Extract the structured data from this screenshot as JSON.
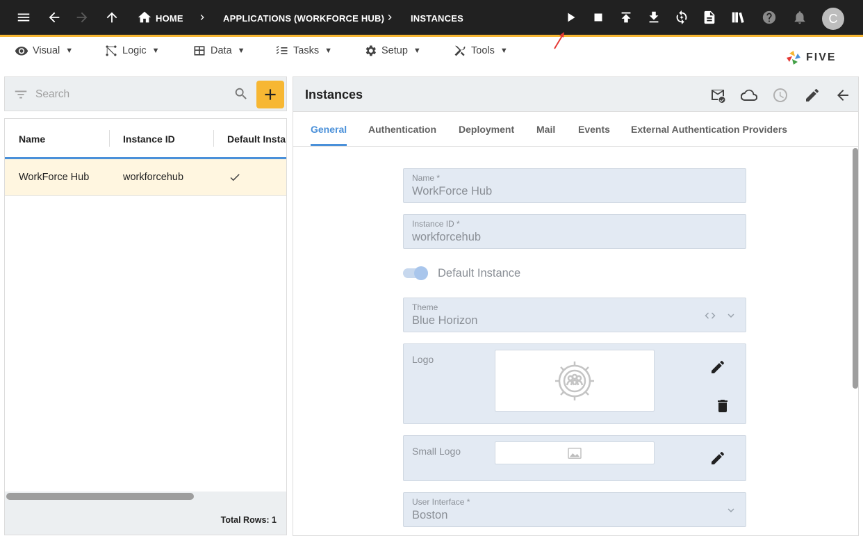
{
  "topbar": {
    "breadcrumbs": [
      "HOME",
      "APPLICATIONS (WORKFORCE HUB)",
      "INSTANCES"
    ],
    "avatar_initial": "C",
    "icons": [
      "menu-icon",
      "back-arrow-icon",
      "forward-arrow-icon",
      "up-arrow-icon",
      "home-icon",
      "play-icon",
      "stop-icon",
      "publish-icon",
      "download-icon",
      "sync-icon",
      "document-icon",
      "library-icon",
      "help-icon",
      "notifications-icon"
    ]
  },
  "menubar": {
    "items": [
      {
        "label": "Visual",
        "icon": "eye-icon"
      },
      {
        "label": "Logic",
        "icon": "flow-icon"
      },
      {
        "label": "Data",
        "icon": "table-icon"
      },
      {
        "label": "Tasks",
        "icon": "checklist-icon"
      },
      {
        "label": "Setup",
        "icon": "gear-icon"
      },
      {
        "label": "Tools",
        "icon": "tools-icon"
      }
    ],
    "caret": "▼",
    "brand": "FIVE"
  },
  "list": {
    "search_placeholder": "Search",
    "columns": [
      "Name",
      "Instance ID",
      "Default Instar"
    ],
    "rows": [
      {
        "name": "WorkForce Hub",
        "instance_id": "workforcehub",
        "default": true
      }
    ],
    "total_rows": "Total Rows: 1"
  },
  "detail": {
    "title": "Instances",
    "tabs": [
      "General",
      "Authentication",
      "Deployment",
      "Mail",
      "Events",
      "External Authentication Providers"
    ],
    "active_tab": "General",
    "fields": {
      "name": {
        "label": "Name *",
        "value": "WorkForce Hub"
      },
      "instance_id": {
        "label": "Instance ID *",
        "value": "workforcehub"
      },
      "default_instance": {
        "label": "Default Instance",
        "value": true
      },
      "theme": {
        "label": "Theme",
        "value": "Blue Horizon"
      },
      "logo": {
        "label": "Logo"
      },
      "small_logo": {
        "label": "Small Logo"
      },
      "user_interface": {
        "label": "User Interface *",
        "value": "Boston"
      }
    }
  },
  "colors": {
    "topbar_bg": "#212121",
    "accent_yellow": "#f7b733",
    "accent_blue": "#4a90d9",
    "selected_row": "#fff6e0",
    "field_bg": "#e3eaf3"
  }
}
